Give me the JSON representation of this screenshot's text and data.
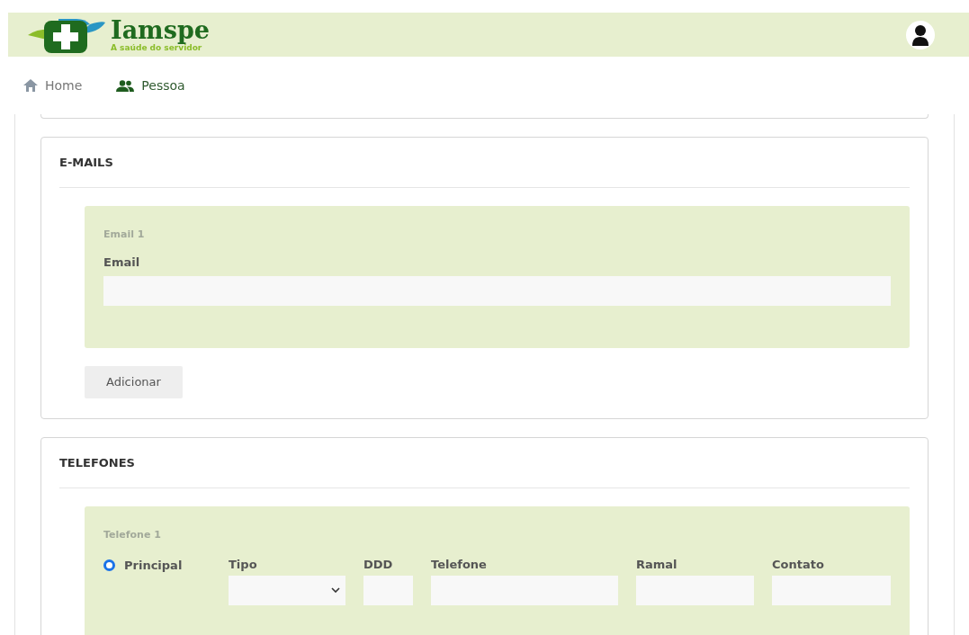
{
  "header": {
    "brand": "Iamspe",
    "tagline": "A saúde do servidor"
  },
  "nav": [
    {
      "label": "Home",
      "selected": false
    },
    {
      "label": "Pessoa",
      "selected": true
    }
  ],
  "emails": {
    "title": "E-MAILS",
    "items": [
      {
        "caption": "Email 1",
        "label": "Email"
      }
    ],
    "add_button": "Adicionar"
  },
  "phones": {
    "title": "TELEFONES",
    "items": [
      {
        "caption": "Telefone 1",
        "principal": {
          "label": "Principal",
          "selected": true
        },
        "fields": [
          {
            "label": "Tipo",
            "kind": "select"
          },
          {
            "label": "DDD",
            "kind": "text"
          },
          {
            "label": "Telefone",
            "kind": "text"
          },
          {
            "label": "Ramal",
            "kind": "text"
          },
          {
            "label": "Contato",
            "kind": "text"
          }
        ]
      }
    ]
  }
}
